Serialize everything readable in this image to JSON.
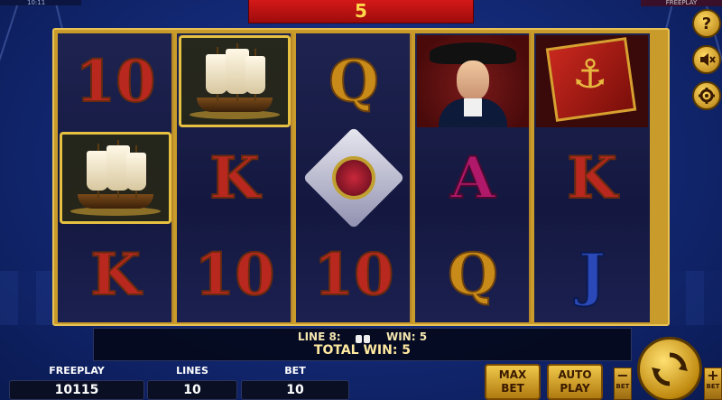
{
  "top": {
    "left_status": "10:11",
    "right_status": "FREEPLAY",
    "counter": "5"
  },
  "reels": [
    [
      "10",
      "ship",
      "K"
    ],
    [
      "ship",
      "K",
      "10"
    ],
    [
      "Q",
      "medal",
      "10"
    ],
    [
      "admiral",
      "A",
      "Q"
    ],
    [
      "book",
      "K",
      "J"
    ]
  ],
  "info": {
    "line_label": "LINE 8:",
    "win_label": "WIN: 5",
    "total_win": "TOTAL WIN: 5"
  },
  "bottom": {
    "freeplay_label": "FREEPLAY",
    "freeplay_value": "10115",
    "lines_label": "LINES",
    "lines_value": "10",
    "bet_label": "BET",
    "bet_value": "10",
    "max_bet_line1": "MAX",
    "max_bet_line2": "BET",
    "auto_play_line1": "AUTO",
    "auto_play_line2": "PLAY",
    "bet_minus": "−",
    "bet_minus_label": "BET",
    "bet_plus": "+",
    "bet_plus_label": "BET"
  },
  "side": {
    "help": "?",
    "sound_icon": "speaker-muted-icon",
    "settings_icon": "gear-icon"
  },
  "colors": {
    "gold": "#c89b2a",
    "red_counter": "#d41818",
    "background": "#142a78"
  }
}
